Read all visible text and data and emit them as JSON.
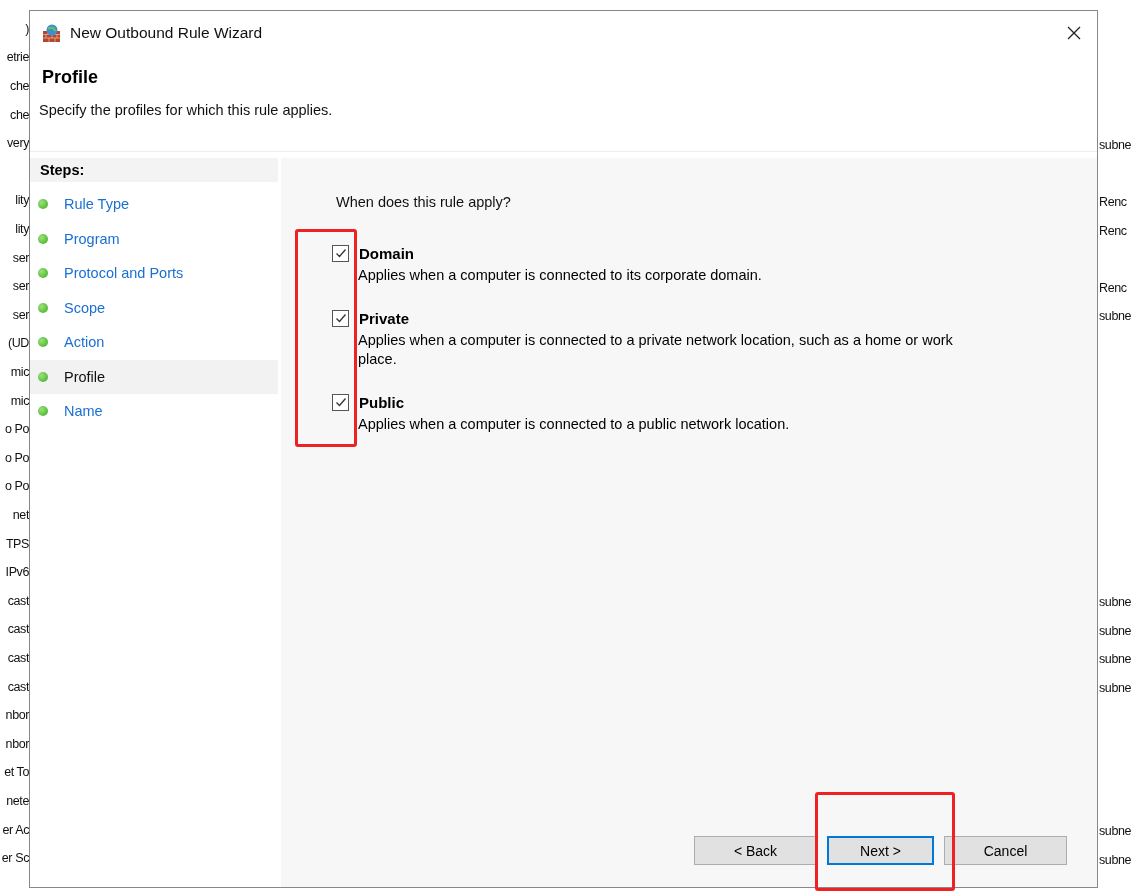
{
  "background_table": {
    "rows": [
      {
        "column_1": "",
        "column_2": ""
      },
      {
        "column_1": ")",
        "column_2": ""
      },
      {
        "column_1": "etrie",
        "column_2": ""
      },
      {
        "column_1": "che",
        "column_2": ""
      },
      {
        "column_1": "che",
        "column_2": ""
      },
      {
        "column_1": "very",
        "column_2": "subne"
      },
      {
        "column_1": "",
        "column_2": ""
      },
      {
        "column_1": "lity",
        "column_2": "Renc"
      },
      {
        "column_1": "lity",
        "column_2": "Renc"
      },
      {
        "column_1": "ser",
        "column_2": ""
      },
      {
        "column_1": "ser",
        "column_2": "Renc"
      },
      {
        "column_1": "ser",
        "column_2": "subne"
      },
      {
        "column_1": "(UD",
        "column_2": ""
      },
      {
        "column_1": "mic",
        "column_2": ""
      },
      {
        "column_1": "mic",
        "column_2": ""
      },
      {
        "column_1": "o Po",
        "column_2": ""
      },
      {
        "column_1": "o Po",
        "column_2": ""
      },
      {
        "column_1": "o Po",
        "column_2": ""
      },
      {
        "column_1": "net",
        "column_2": ""
      },
      {
        "column_1": "TPS",
        "column_2": ""
      },
      {
        "column_1": "IPv6",
        "column_2": ""
      },
      {
        "column_1": "cast",
        "column_2": "subne"
      },
      {
        "column_1": "cast",
        "column_2": "subne"
      },
      {
        "column_1": "cast",
        "column_2": "subne"
      },
      {
        "column_1": "cast",
        "column_2": "subne"
      },
      {
        "column_1": "nbor",
        "column_2": ""
      },
      {
        "column_1": "nbor",
        "column_2": ""
      },
      {
        "column_1": "et To",
        "column_2": ""
      },
      {
        "column_1": "nete",
        "column_2": ""
      },
      {
        "column_1": "er Ac",
        "column_2": "subne"
      },
      {
        "column_1": "er Sc",
        "column_2": "subne"
      }
    ]
  },
  "dialog": {
    "title": "New Outbound Rule Wizard",
    "heading": "Profile",
    "subtitle": "Specify the profiles for which this rule applies.",
    "steps_title": "Steps:",
    "steps": [
      {
        "label": "Rule Type",
        "selected": false
      },
      {
        "label": "Program",
        "selected": false
      },
      {
        "label": "Protocol and Ports",
        "selected": false
      },
      {
        "label": "Scope",
        "selected": false
      },
      {
        "label": "Action",
        "selected": false
      },
      {
        "label": "Profile",
        "selected": true
      },
      {
        "label": "Name",
        "selected": false
      }
    ],
    "question": "When does this rule apply?",
    "profiles": [
      {
        "label": "Domain",
        "checked": true,
        "description": "Applies when a computer is connected to its corporate domain."
      },
      {
        "label": "Private",
        "checked": true,
        "description": "Applies when a computer is connected to a private network location, such as a home or work place."
      },
      {
        "label": "Public",
        "checked": true,
        "description": "Applies when a computer is connected to a public network location."
      }
    ],
    "buttons": [
      {
        "label": "< Back",
        "default": false
      },
      {
        "label": "Next >",
        "default": true
      },
      {
        "label": "Cancel",
        "default": false
      }
    ]
  }
}
